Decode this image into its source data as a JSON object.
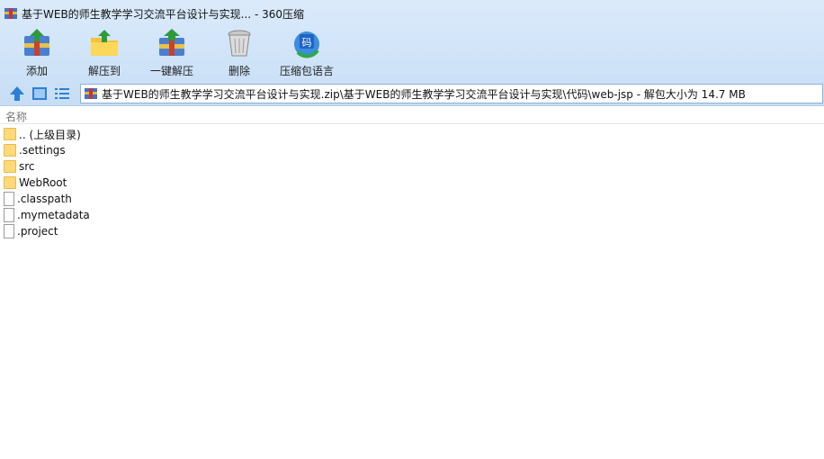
{
  "window": {
    "title": "基于WEB的师生教学学习交流平台设计与实现... - 360压缩"
  },
  "toolbar": {
    "items": [
      {
        "label": "添加",
        "icon": "archive-add-icon"
      },
      {
        "label": "解压到",
        "icon": "extract-to-icon"
      },
      {
        "label": "一键解压",
        "icon": "one-click-extract-icon"
      },
      {
        "label": "删除",
        "icon": "trash-icon"
      },
      {
        "label": "压缩包语言",
        "icon": "archive-language-icon"
      }
    ]
  },
  "nav": {
    "path": "基于WEB的师生教学学习交流平台设计与实现.zip\\基于WEB的师生教学学习交流平台设计与实现\\代码\\web-jsp - 解包大小为 14.7 MB"
  },
  "list": {
    "column_name": "名称",
    "items": [
      {
        "name": ".. (上级目录)",
        "type": "folder"
      },
      {
        "name": ".settings",
        "type": "folder"
      },
      {
        "name": "src",
        "type": "folder"
      },
      {
        "name": "WebRoot",
        "type": "folder"
      },
      {
        "name": ".classpath",
        "type": "file"
      },
      {
        "name": ".mymetadata",
        "type": "file"
      },
      {
        "name": ".project",
        "type": "file"
      }
    ]
  }
}
